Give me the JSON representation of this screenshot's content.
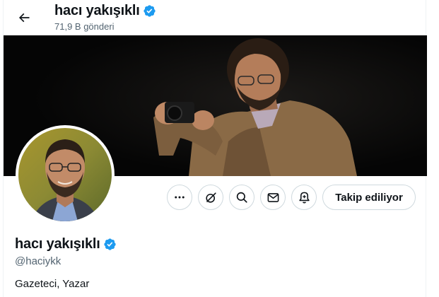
{
  "header": {
    "name": "hacı yakışıklı",
    "posts_count": "71,9 B gönderi",
    "back_icon": "arrow-left-icon"
  },
  "profile": {
    "name": "hacı yakışıklı",
    "handle": "@haciykk",
    "bio": "Gazeteci, Yazar",
    "verified_color": "#1d9bf0"
  },
  "actions": {
    "more_icon": "more-icon",
    "grok_icon": "grok-icon",
    "search_icon": "search-icon",
    "message_icon": "mail-icon",
    "notify_icon": "bell-plus-icon",
    "follow_label": "Takip ediliyor"
  }
}
